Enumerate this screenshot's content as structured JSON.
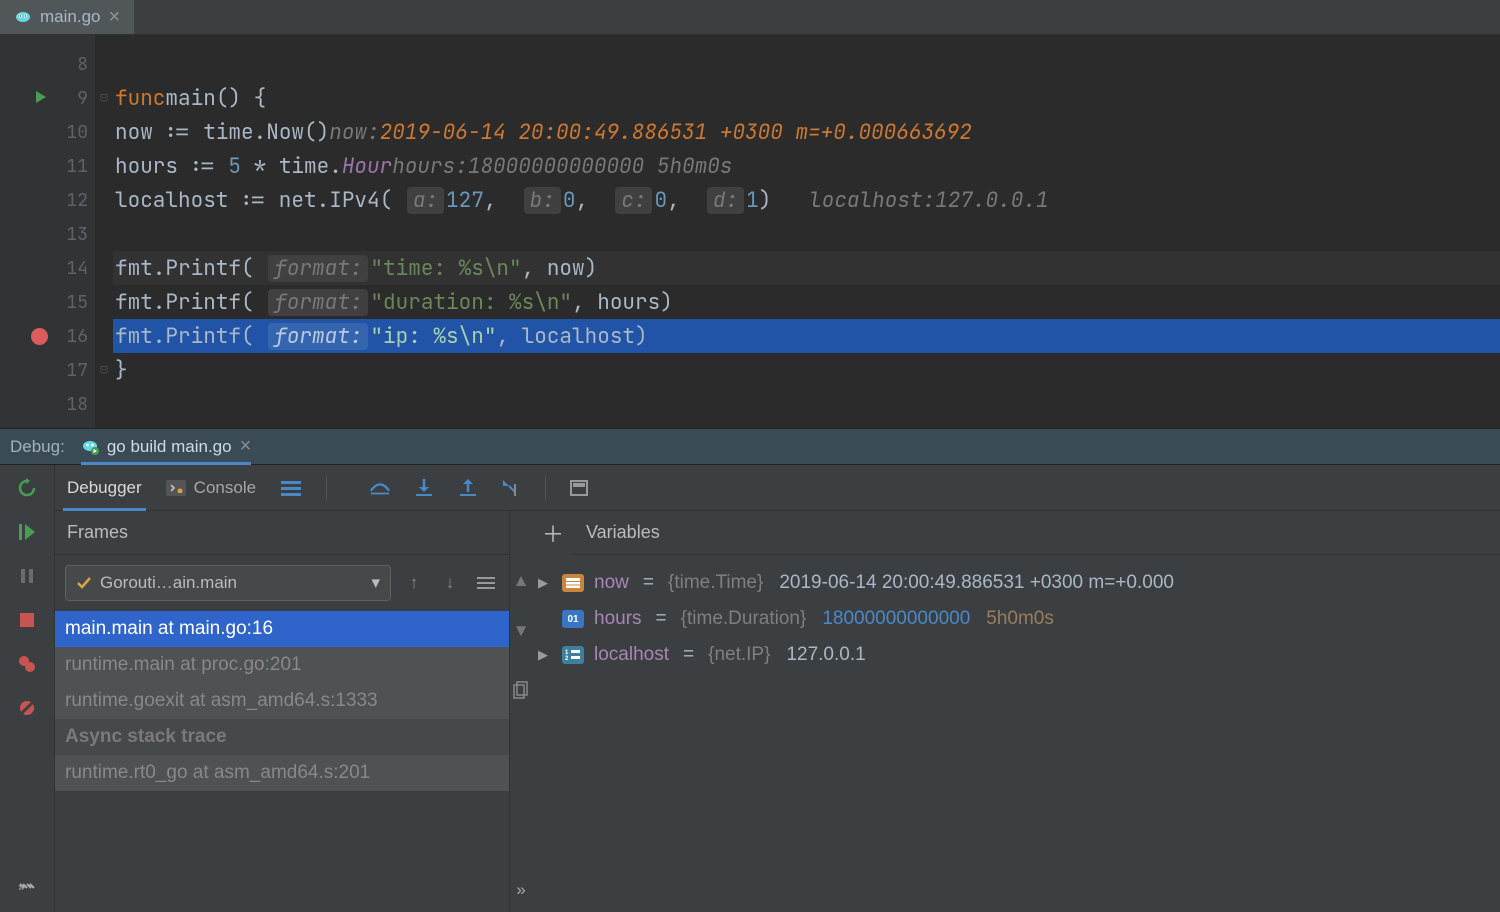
{
  "tab": {
    "label": "main.go"
  },
  "gutter": {
    "lines": [
      "8",
      "9",
      "10",
      "11",
      "12",
      "13",
      "14",
      "15",
      "16",
      "17",
      "18"
    ],
    "breakpoint_line": 16,
    "run_icon_line": 9
  },
  "code": {
    "l9": {
      "pre": "func",
      "fn": "main",
      "rest": "() {"
    },
    "l10": {
      "var": "now",
      "op": " := ",
      "pkg": "time.",
      "call": "Now",
      "paren": "()",
      "inlay_var": "now:",
      "inlay_val": "2019-06-14 20:00:49.886531 +0300 m=+0.000663692"
    },
    "l11": {
      "var": "hours",
      "op": " := ",
      "num": "5",
      "star": " * ",
      "pkg": "time.",
      "const": "Hour",
      "inlay_var": "hours:",
      "inlay_val": "18000000000000 5h0m0s"
    },
    "l12a": {
      "var": "localhost",
      "op": " := net.",
      "call": "IPv4",
      "p_open": "( "
    },
    "l12_hints": {
      "a": "a:",
      "av": "127",
      "b": "b:",
      "bv": "0",
      "c": "c:",
      "cv": "0",
      "d": "d:",
      "dv": "1"
    },
    "l12b": {
      "inlay_var": "localhost:",
      "inlay_val": "127.0.0.1"
    },
    "l14": {
      "pkg": "fmt.",
      "call": "Printf",
      "hint": "format:",
      "str": "\"time: %s\\n\"",
      "rest": ", now)"
    },
    "l15": {
      "pkg": "fmt.",
      "call": "Printf",
      "hint": "format:",
      "str": "\"duration: %s\\n\"",
      "rest": ", hours)"
    },
    "l16": {
      "pkg": "fmt.",
      "call": "Printf",
      "hint": "format:",
      "str": "\"ip: %s\\n\"",
      "rest": ", localhost)"
    },
    "l17": "}"
  },
  "debugHeader": {
    "label": "Debug:",
    "tab": "go build main.go"
  },
  "dbgTabs": {
    "debugger": "Debugger",
    "console": "Console"
  },
  "framesPanel": {
    "title": "Frames",
    "dropdown": "Gorouti…ain.main",
    "frames": [
      "main.main at main.go:16",
      "runtime.main at proc.go:201",
      "runtime.goexit at asm_amd64.s:1333"
    ],
    "async_header": "Async stack trace",
    "async_frames": [
      "runtime.rt0_go at asm_amd64.s:201"
    ]
  },
  "varsPanel": {
    "title": "Variables",
    "vars": [
      {
        "name": "now",
        "type": "{time.Time}",
        "value": "2019-06-14 20:00:49.886531 +0300 m=+0.000",
        "badge": "struct",
        "expandable": true
      },
      {
        "name": "hours",
        "type": "{time.Duration}",
        "value": "18000000000000",
        "hint": "5h0m0s",
        "badge": "num",
        "expandable": false
      },
      {
        "name": "localhost",
        "type": "{net.IP}",
        "value": "127.0.0.1",
        "badge": "slice",
        "expandable": true
      }
    ]
  }
}
